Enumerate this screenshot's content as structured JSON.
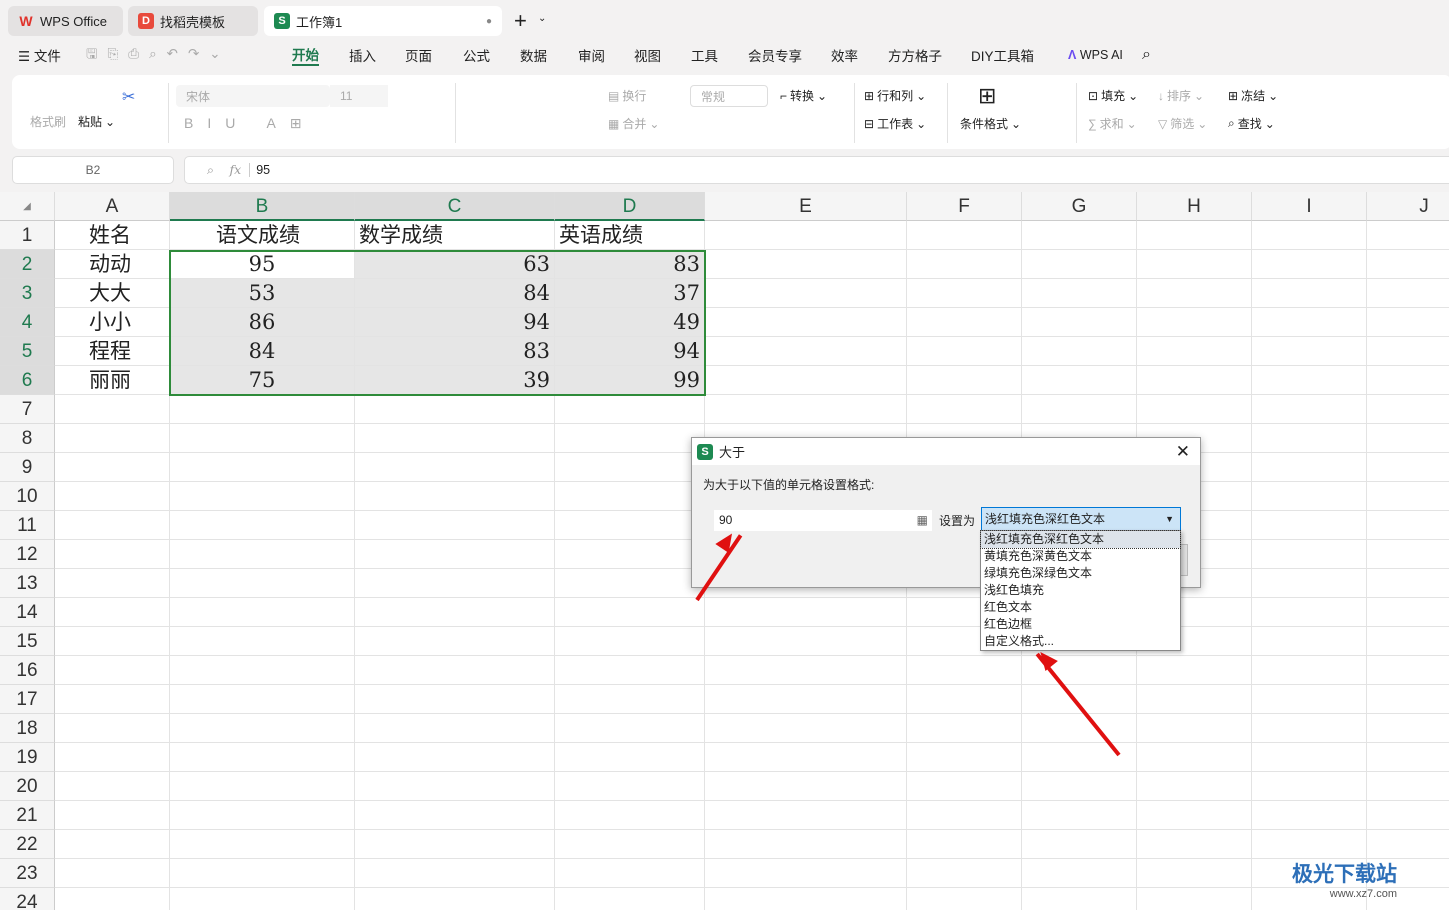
{
  "tabs": [
    {
      "label": "WPS Office",
      "icon": "wps-logo-icon"
    },
    {
      "label": "找稻壳模板",
      "icon": "docer-icon"
    },
    {
      "label": "工作簿1",
      "icon": "sheet-icon"
    }
  ],
  "menu": {
    "file": "文件",
    "items": [
      "开始",
      "插入",
      "页面",
      "公式",
      "数据",
      "审阅",
      "视图",
      "工具",
      "会员专享",
      "效率",
      "方方格子",
      "DIY工具箱"
    ],
    "ai": "WPS AI"
  },
  "ribbon": {
    "format_painter": "格式刷",
    "paste": "粘贴",
    "font": "宋体",
    "size": "11",
    "wrap": "换行",
    "merge": "合并",
    "number_format": "常规",
    "convert": "转换",
    "rows_cols": "行和列",
    "worksheet": "工作表",
    "cond_format": "条件格式",
    "fill": "填充",
    "sort": "排序",
    "freeze": "冻结",
    "sum": "求和",
    "filter": "筛选",
    "find": "查找"
  },
  "formula_bar": {
    "cell_ref": "B2",
    "fx": "fx",
    "value": "95"
  },
  "sheet": {
    "columns": [
      "A",
      "B",
      "C",
      "D",
      "E",
      "F",
      "G",
      "H",
      "I",
      "J"
    ],
    "rows": [
      "1",
      "2",
      "3",
      "4",
      "5",
      "6",
      "7",
      "8",
      "9",
      "10",
      "11",
      "12",
      "13",
      "14",
      "15",
      "16",
      "17",
      "18",
      "19",
      "20",
      "21",
      "22",
      "23",
      "24"
    ],
    "headers": [
      "姓名",
      "语文成绩",
      "数学成绩",
      "英语成绩"
    ],
    "data": [
      [
        "动动",
        "95",
        "63",
        "83"
      ],
      [
        "大大",
        "53",
        "84",
        "37"
      ],
      [
        "小小",
        "86",
        "94",
        "49"
      ],
      [
        "程程",
        "84",
        "83",
        "94"
      ],
      [
        "丽丽",
        "75",
        "39",
        "99"
      ]
    ]
  },
  "dialog": {
    "title": "大于",
    "prompt": "为大于以下值的单元格设置格式:",
    "value": "90",
    "set_as": "设置为",
    "selected": "浅红填充色深红色文本",
    "options": [
      "浅红填充色深红色文本",
      "黄填充色深黄色文本",
      "绿填充色深绿色文本",
      "浅红色填充",
      "红色文本",
      "红色边框",
      "自定义格式..."
    ]
  },
  "watermark": {
    "name": "极光下载站",
    "url": "www.xz7.com"
  },
  "colors": {
    "accent": "#1f7a4f",
    "selection": "#2e8b3a",
    "arrow": "#e01010"
  }
}
